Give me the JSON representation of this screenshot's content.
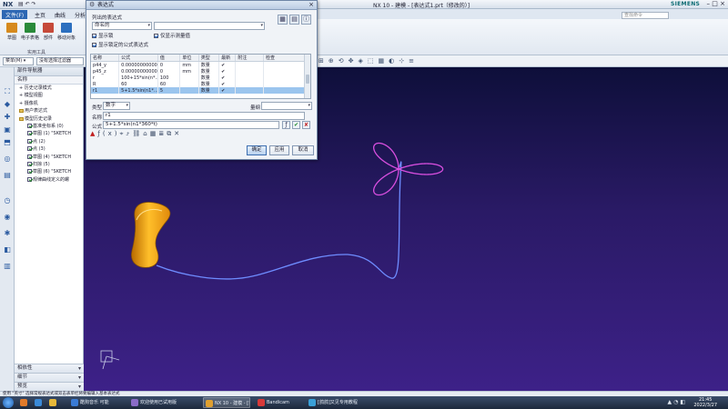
{
  "window": {
    "app_name": "NX",
    "doc_title": "NX 10 - 建模 - [表达式1.prt（修改的）]",
    "brand": "SIEMENS",
    "qat_undo": "↶",
    "qat_redo": "↷"
  },
  "ribbon": {
    "tabs": [
      "文件(F)",
      "主页",
      "曲线",
      "分析"
    ],
    "search_placeholder": "查找命令",
    "buttons": [
      {
        "label": "草图",
        "color": "#d68a1e"
      },
      {
        "label": "电子表格",
        "color": "#2a8a3a"
      },
      {
        "label": "部件",
        "color": "#c64a3a"
      },
      {
        "label": "移动对象",
        "color": "#2c6fbf"
      }
    ],
    "group_label": "实用工具"
  },
  "toolbar2": {
    "menu_label": "菜单(M) ▾",
    "filter_value": "没有选择过滤器"
  },
  "navigator": {
    "title": "部件导航器",
    "column": "名称",
    "rows": [
      {
        "text": "历史记录模式",
        "type": "item",
        "indent": 1
      },
      {
        "text": "模型视图",
        "type": "item",
        "indent": 1
      },
      {
        "text": "摄像机",
        "type": "item",
        "indent": 1
      },
      {
        "text": "用户表达式",
        "type": "fold",
        "indent": 1
      },
      {
        "text": "模型历史记录",
        "type": "fold",
        "indent": 1
      },
      {
        "text": "基准坐标系 (0)",
        "type": "check",
        "indent": 2
      },
      {
        "text": "草图 (1) \"SKETCH",
        "type": "check",
        "indent": 2
      },
      {
        "text": "点 (2)",
        "type": "check",
        "indent": 2
      },
      {
        "text": "点 (3)",
        "type": "check",
        "indent": 2
      },
      {
        "text": "草图 (4) \"SKETCH",
        "type": "check",
        "indent": 2
      },
      {
        "text": "扫掠 (5)",
        "type": "check",
        "indent": 2
      },
      {
        "text": "草图 (6) \"SKETCH",
        "type": "check",
        "indent": 2
      },
      {
        "text": "规律曲线定义的螺",
        "type": "check",
        "indent": 2
      }
    ],
    "sections": [
      "相依性",
      "细节",
      "预览"
    ]
  },
  "dialog": {
    "title": "表达式",
    "list_label": "列出的表达式",
    "list_value": "命名的",
    "check_show_locked": "显示锁",
    "check_only_show_dims": "仅显示测量值",
    "check_show_formula": "显示锁定的公式表达式",
    "table": {
      "headers": [
        "名称",
        "公式",
        "值",
        "单位",
        "类型",
        "最新",
        "附注",
        "检查"
      ],
      "rows": [
        {
          "name": "p44_y",
          "formula": "0.00000000000",
          "value": "0",
          "unit": "mm",
          "type": "数量",
          "ok": "✔"
        },
        {
          "name": "p45_z",
          "formula": "0.00000000000",
          "value": "0",
          "unit": "mm",
          "type": "数量",
          "ok": "✔"
        },
        {
          "name": "r",
          "formula": "100+15*sin(n*…",
          "value": "100",
          "unit": "",
          "type": "数量",
          "ok": "✔"
        },
        {
          "name": "R",
          "formula": "60",
          "value": "60",
          "unit": "",
          "type": "数量",
          "ok": "✔"
        },
        {
          "name": "r1",
          "formula": "5+1.5*sin(n1*…",
          "value": "5",
          "unit": "",
          "type": "数量",
          "ok": "✔",
          "selected": true
        }
      ]
    },
    "type_label": "类型",
    "type_value": "数字",
    "dim_label": "量纲",
    "dim_value": "无",
    "name_label": "名称",
    "name_value": "r1",
    "formula_label": "公式",
    "formula_value": "5+1.5*sin(n1*360*t)",
    "buttons": {
      "ok": "确定",
      "apply": "应用",
      "cancel": "取消"
    }
  },
  "status_line": "使用 \"英寸\" 选择常规表达式或双击表单栏将要编辑入基本表达式",
  "taskbar": {
    "apps": [
      {
        "label": "酷狗音乐 可能",
        "color": "#3a7bd5"
      },
      {
        "label": "欢迎使用已试用版",
        "color": "#8a6cc8"
      },
      {
        "label": "NX 10 - 建模 - [表",
        "color": "#e0a030",
        "active": true
      },
      {
        "label": "Bandicam",
        "color": "#d83a3a"
      },
      {
        "label": "[鸽鸽]又见专用教程",
        "color": "#3aa0d8"
      }
    ],
    "time": "21:45",
    "date": "2022/3/27"
  },
  "colors": {
    "flower": "#d94fe0",
    "curve": "#6e8cff",
    "solid": "#f0a31a"
  }
}
